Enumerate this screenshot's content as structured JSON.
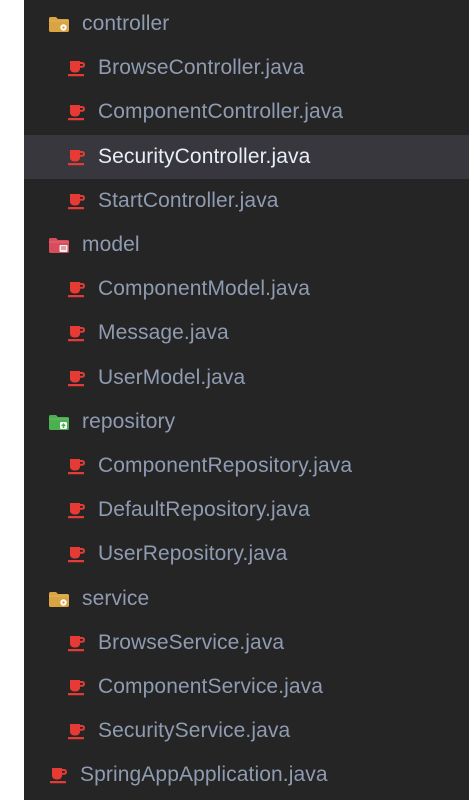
{
  "explorer": {
    "items": [
      {
        "type": "folder",
        "label": "controller",
        "icon": "folder-gear-icon",
        "color": "#d9a441",
        "badge_color": "#ffffff",
        "selected": false
      },
      {
        "type": "file",
        "label": "BrowseController.java",
        "icon": "java-file-icon",
        "color": "#e63b35",
        "selected": false
      },
      {
        "type": "file",
        "label": "ComponentController.java",
        "icon": "java-file-icon",
        "color": "#e63b35",
        "selected": false
      },
      {
        "type": "file",
        "label": "SecurityController.java",
        "icon": "java-file-icon",
        "color": "#e63b35",
        "selected": true
      },
      {
        "type": "file",
        "label": "StartController.java",
        "icon": "java-file-icon",
        "color": "#e63b35",
        "selected": false
      },
      {
        "type": "folder",
        "label": "model",
        "icon": "folder-model-icon",
        "color": "#d94c5b",
        "badge_color": "#f0f0f0",
        "selected": false
      },
      {
        "type": "file",
        "label": "ComponentModel.java",
        "icon": "java-file-icon",
        "color": "#e63b35",
        "selected": false
      },
      {
        "type": "file",
        "label": "Message.java",
        "icon": "java-file-icon",
        "color": "#e63b35",
        "selected": false
      },
      {
        "type": "file",
        "label": "UserModel.java",
        "icon": "java-file-icon",
        "color": "#e63b35",
        "selected": false
      },
      {
        "type": "folder",
        "label": "repository",
        "icon": "folder-repository-icon",
        "color": "#4caf50",
        "badge_color": "#ffffff",
        "selected": false
      },
      {
        "type": "file",
        "label": "ComponentRepository.java",
        "icon": "java-file-icon",
        "color": "#e63b35",
        "selected": false
      },
      {
        "type": "file",
        "label": "DefaultRepository.java",
        "icon": "java-file-icon",
        "color": "#e63b35",
        "selected": false
      },
      {
        "type": "file",
        "label": "UserRepository.java",
        "icon": "java-file-icon",
        "color": "#e63b35",
        "selected": false
      },
      {
        "type": "folder",
        "label": "service",
        "icon": "folder-gear-icon",
        "color": "#d9a441",
        "badge_color": "#ffffff",
        "selected": false
      },
      {
        "type": "file",
        "label": "BrowseService.java",
        "icon": "java-file-icon",
        "color": "#e63b35",
        "selected": false
      },
      {
        "type": "file",
        "label": "ComponentService.java",
        "icon": "java-file-icon",
        "color": "#e63b35",
        "selected": false
      },
      {
        "type": "file",
        "label": "SecurityService.java",
        "icon": "java-file-icon",
        "color": "#e63b35",
        "selected": false
      },
      {
        "type": "root-file",
        "label": "SpringAppApplication.java",
        "icon": "java-file-icon",
        "color": "#e63b35",
        "selected": false
      }
    ]
  }
}
